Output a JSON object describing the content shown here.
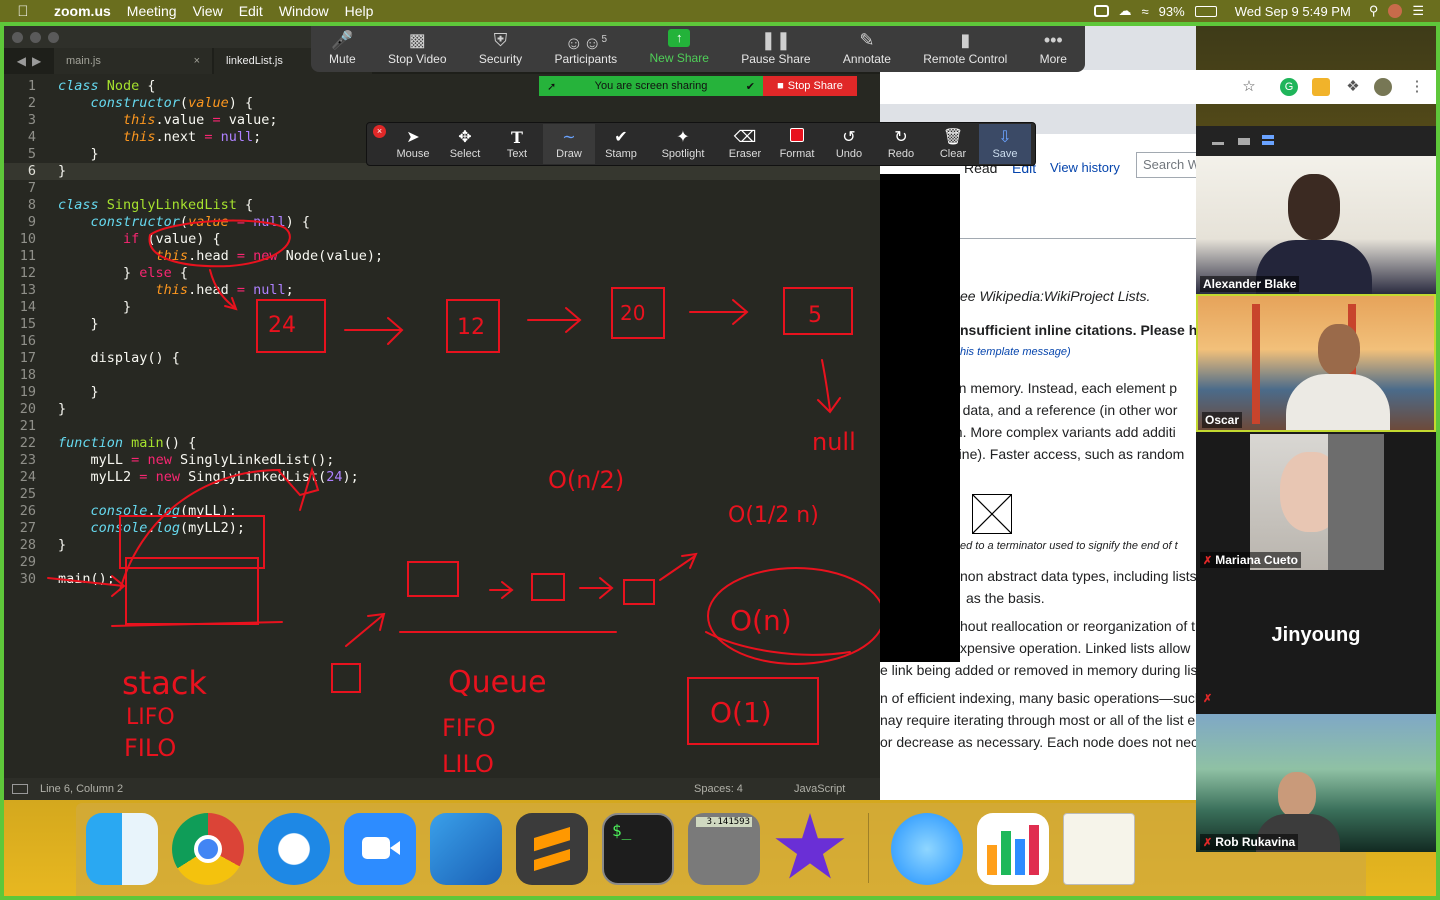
{
  "menubar": {
    "app": "zoom.us",
    "menus": [
      "Meeting",
      "View",
      "Edit",
      "Window",
      "Help"
    ],
    "battery": "93%",
    "datetime": "Wed Sep 9  5:49 PM"
  },
  "zoom_toolbar": {
    "buttons": [
      {
        "label": "Mute",
        "icon": "microphone-icon"
      },
      {
        "label": "Stop Video",
        "icon": "video-camera-icon"
      },
      {
        "label": "Security",
        "icon": "shield-icon"
      },
      {
        "label": "Participants",
        "icon": "participants-icon",
        "count": "5"
      },
      {
        "label": "New Share",
        "icon": "share-arrow-icon"
      },
      {
        "label": "Pause Share",
        "icon": "pause-icon"
      },
      {
        "label": "Annotate",
        "icon": "pencil-icon"
      },
      {
        "label": "Remote Control",
        "icon": "mouse-icon"
      },
      {
        "label": "More",
        "icon": "more-dots-icon"
      }
    ]
  },
  "share_banner": {
    "status": "You are screen sharing",
    "stop": "Stop Share"
  },
  "annotation_toolbar": {
    "tools": [
      "Mouse",
      "Select",
      "Text",
      "Draw",
      "Stamp",
      "Spotlight",
      "Eraser",
      "Format",
      "Undo",
      "Redo",
      "Clear",
      "Save"
    ],
    "selected": "Draw"
  },
  "editor": {
    "tabs": [
      {
        "label": "main.js",
        "active": false
      },
      {
        "label": "linkedList.js",
        "active": true
      }
    ],
    "current_line": 6,
    "status": {
      "position": "Line 6, Column 2",
      "spaces": "Spaces: 4",
      "syntax": "JavaScript"
    }
  },
  "browser": {
    "tabs": [
      "Read",
      "Edit",
      "View history"
    ],
    "search_placeholder": "Search W",
    "lines": [
      "ee Wikipedia:WikiProject Lists.",
      "nsufficient inline citations. Please h",
      "his template message)",
      "nt in memory. Instead, each element p",
      "ns: data, and a reference (in other wor",
      "tion. More complex variants add additi",
      "peline). Faster access, such as random",
      "ed to a terminator used to signify the end of t",
      "non abstract data types, including lists,",
      "as the basis.",
      "hout reallocation or reorganization of th",
      "xpensive operation. Linked lists allow",
      "e link being added or removed in memory during lis",
      "n of efficient indexing, many basic operations—such",
      "nay require iterating through most or all of the list el",
      "or decrease as necessary. Each node does not nece"
    ]
  },
  "participants": [
    {
      "name": "Alexander Blake",
      "muted": false
    },
    {
      "name": "Oscar",
      "muted": false
    },
    {
      "name": "Mariana Cueto",
      "muted": true
    },
    {
      "name": "Jinyoung",
      "muted": true
    },
    {
      "name": "Rob Rukavina",
      "muted": true
    }
  ],
  "annotations": {
    "nodes": [
      "24",
      "12",
      "20",
      "5"
    ],
    "null_label": "null",
    "complexities": [
      "O(n/2)",
      "O(1/2 n)",
      "O(n)",
      "O(1)"
    ],
    "stack": {
      "title": "stack",
      "rule1": "LIFO",
      "rule2": "FILO"
    },
    "queue": {
      "title": "Queue",
      "rule1": "FIFO",
      "rule2": "LILO"
    },
    "color": "#e8121e"
  },
  "dock": {
    "apps": [
      "Finder",
      "Google Chrome",
      "Safari",
      "Zoom",
      "Xcode",
      "Sublime Text",
      "Terminal",
      "Calculator",
      "iMovie",
      "Messages",
      "Numbers",
      "TextEdit"
    ],
    "calculator_display": "3.141593"
  }
}
